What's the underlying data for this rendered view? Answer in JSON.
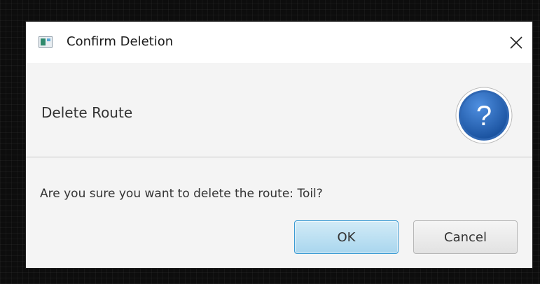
{
  "window": {
    "title": "Confirm Deletion",
    "close_glyph": "✕"
  },
  "header": {
    "text": "Delete Route",
    "icon": "question-icon",
    "icon_glyph": "?"
  },
  "content": {
    "message": "Are you sure you want to delete the route: Toil?"
  },
  "buttons": {
    "ok_label": "OK",
    "cancel_label": "Cancel"
  },
  "colors": {
    "accent": "#3c9bd3",
    "icon_blue": "#1f63b8",
    "panel_bg": "#f4f4f4"
  }
}
